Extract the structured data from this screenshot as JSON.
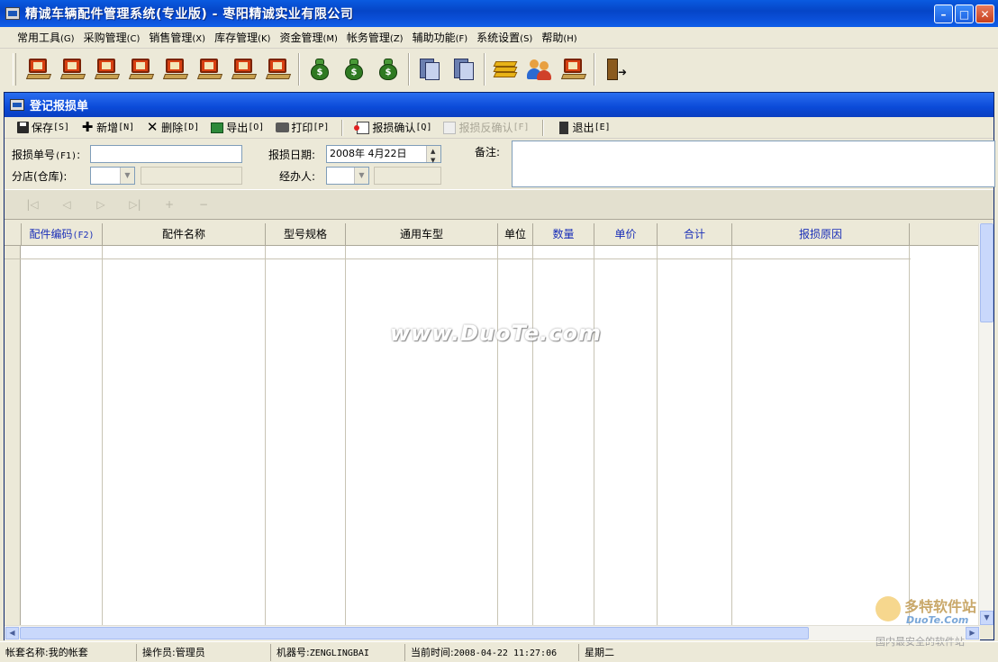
{
  "window": {
    "title": "精诚车辆配件管理系统(专业版) - 枣阳精诚实业有限公司"
  },
  "menu": [
    {
      "label": "常用工具",
      "hotkey": "(G)"
    },
    {
      "label": "采购管理",
      "hotkey": "(C)"
    },
    {
      "label": "销售管理",
      "hotkey": "(X)"
    },
    {
      "label": "库存管理",
      "hotkey": "(K)"
    },
    {
      "label": "资金管理",
      "hotkey": "(M)"
    },
    {
      "label": "帐务管理",
      "hotkey": "(Z)"
    },
    {
      "label": "辅助功能",
      "hotkey": "(F)"
    },
    {
      "label": "系统设置",
      "hotkey": "(S)"
    },
    {
      "label": "帮助",
      "hotkey": "(H)"
    }
  ],
  "doc": {
    "title": "登记报损单",
    "actions": {
      "save": {
        "label": "保存",
        "hotkey": "[S]"
      },
      "add": {
        "label": "新增",
        "hotkey": "[N]"
      },
      "delete": {
        "label": "删除",
        "hotkey": "[D]"
      },
      "export": {
        "label": "导出",
        "hotkey": "[O]"
      },
      "print": {
        "label": "打印",
        "hotkey": "[P]"
      },
      "confirm": {
        "label": "报损确认",
        "hotkey": "[Q]"
      },
      "unconfirm": {
        "label": "报损反确认",
        "hotkey": "[F]"
      },
      "exit": {
        "label": "退出",
        "hotkey": "[E]"
      }
    },
    "form": {
      "order_no_label": "报损单号",
      "order_no_hotkey": "(F1)",
      "order_no_value": "",
      "branch_label": "分店(仓库):",
      "date_label": "报损日期:",
      "date_value": "2008年 4月22日",
      "handler_label": "经办人:",
      "memo_label": "备注:"
    },
    "nav": [
      "|◁",
      "◁",
      "▷",
      "▷|",
      "+",
      "−"
    ],
    "grid": {
      "columns": [
        {
          "label": "配件编码",
          "hotkey": "(F2)",
          "blue": true
        },
        {
          "label": "配件名称",
          "hotkey": "",
          "blue": false
        },
        {
          "label": "型号规格",
          "hotkey": "",
          "blue": false
        },
        {
          "label": "通用车型",
          "hotkey": "",
          "blue": false
        },
        {
          "label": "单位",
          "hotkey": "",
          "blue": false
        },
        {
          "label": "数量",
          "hotkey": "",
          "blue": true
        },
        {
          "label": "单价",
          "hotkey": "",
          "blue": true
        },
        {
          "label": "合计",
          "hotkey": "",
          "blue": true
        },
        {
          "label": "报损原因",
          "hotkey": "",
          "blue": true
        }
      ]
    }
  },
  "watermark": "www.DuoTe.com",
  "logo": {
    "name": "多特软件站",
    "site": "DuoTe.Com",
    "slogan": "国内最安全的软件站"
  },
  "status": {
    "account_label": "帐套名称:",
    "account_value": "我的帐套",
    "operator_label": "操作员:",
    "operator_value": "管理员",
    "machine_label": "机器号:",
    "machine_value": "ZENGLINGBAI",
    "time_label": "当前时间:",
    "time_value": "2008-04-22 11:27:06",
    "weekday": "星期二"
  }
}
